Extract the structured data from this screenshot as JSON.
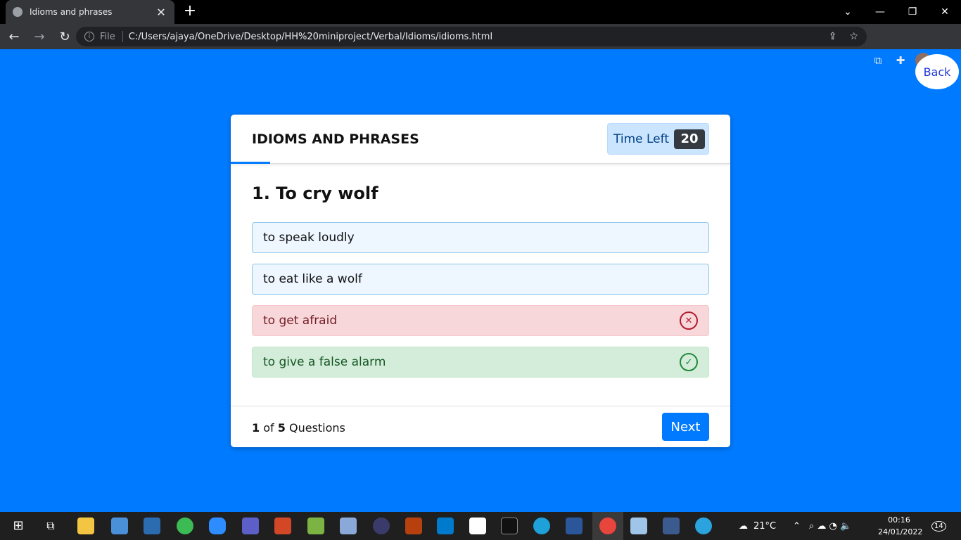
{
  "browser": {
    "tab_title": "Idioms and phrases",
    "tab_close": "✕",
    "new_tab": "+",
    "file_label": "File",
    "url": "C:/Users/ajaya/OneDrive/Desktop/HH%20miniproject/Verbal/Idioms/idioms.html"
  },
  "page": {
    "back_label": "Back",
    "quiz_title": "IDIOMS AND PHRASES",
    "timer_label": "Time Left",
    "timer_value": "20",
    "question": "1. To cry wolf",
    "options": [
      {
        "text": "to speak loudly",
        "state": "neutral"
      },
      {
        "text": "to eat like a wolf",
        "state": "neutral"
      },
      {
        "text": "to get afraid",
        "state": "wrong"
      },
      {
        "text": "to give a false alarm",
        "state": "correct"
      }
    ],
    "counter": {
      "current": "1",
      "of": "of",
      "total": "5",
      "suffix": "Questions"
    },
    "next_label": "Next"
  },
  "taskbar": {
    "weather": "21°C",
    "time": "00:16",
    "date": "24/01/2022",
    "notification_count": "14"
  },
  "colors": {
    "page_bg": "#007bff",
    "correct": "#d4edda",
    "wrong": "#f8d7da",
    "neutral": "#eef7ff"
  }
}
